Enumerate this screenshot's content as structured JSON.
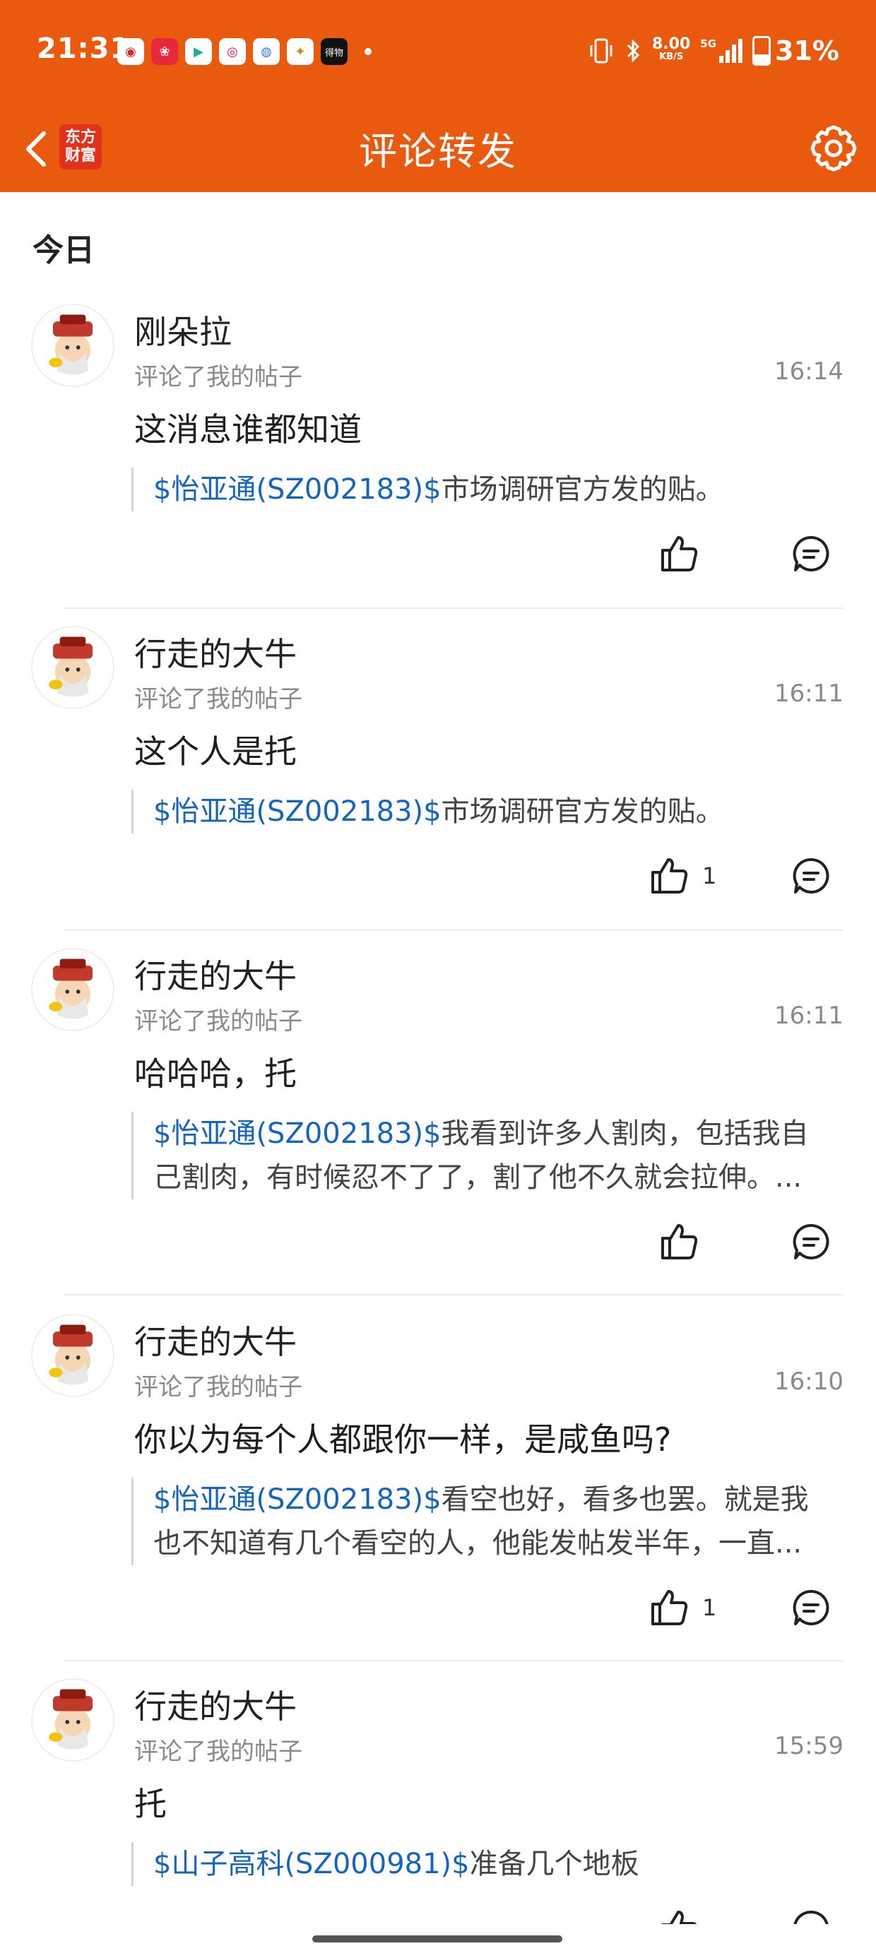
{
  "status_bar": {
    "time": "21:31",
    "net_speed_value": "8.00",
    "net_speed_unit": "KB/S",
    "network": "5G",
    "battery": "31%",
    "notif_badge": "得物"
  },
  "header": {
    "title": "评论转发",
    "logo_line1": "东方",
    "logo_line2": "财富"
  },
  "section_today": "今日",
  "items": [
    {
      "username": "刚朵拉",
      "action": "评论了我的帖子",
      "time": "16:14",
      "comment": "这消息谁都知道",
      "stock": "$怡亚通(SZ002183)$",
      "quote_line1": "市场调研官方发的贴。",
      "quote_line2": "",
      "likes": ""
    },
    {
      "username": "行走的大牛",
      "action": "评论了我的帖子",
      "time": "16:11",
      "comment": "这个人是托",
      "stock": "$怡亚通(SZ002183)$",
      "quote_line1": "市场调研官方发的贴。",
      "quote_line2": "",
      "likes": "1"
    },
    {
      "username": "行走的大牛",
      "action": "评论了我的帖子",
      "time": "16:11",
      "comment": "哈哈哈，托",
      "stock": "$怡亚通(SZ002183)$",
      "quote_line1": "我看到许多人割肉，包括我自",
      "quote_line2": "己割肉，有时候忍不了了，割了他不久就会拉伸。...",
      "likes": ""
    },
    {
      "username": "行走的大牛",
      "action": "评论了我的帖子",
      "time": "16:10",
      "comment": "你以为每个人都跟你一样，是咸鱼吗?",
      "stock": "$怡亚通(SZ002183)$",
      "quote_line1": "看空也好，看多也罢。就是我",
      "quote_line2": "也不知道有几个看空的人，他能发帖发半年，一直...",
      "likes": "1"
    },
    {
      "username": "行走的大牛",
      "action": "评论了我的帖子",
      "time": "15:59",
      "comment": "托",
      "stock": "$山子高科(SZ000981)$",
      "quote_line1": "准备几个地板",
      "quote_line2": "",
      "likes": ""
    }
  ]
}
